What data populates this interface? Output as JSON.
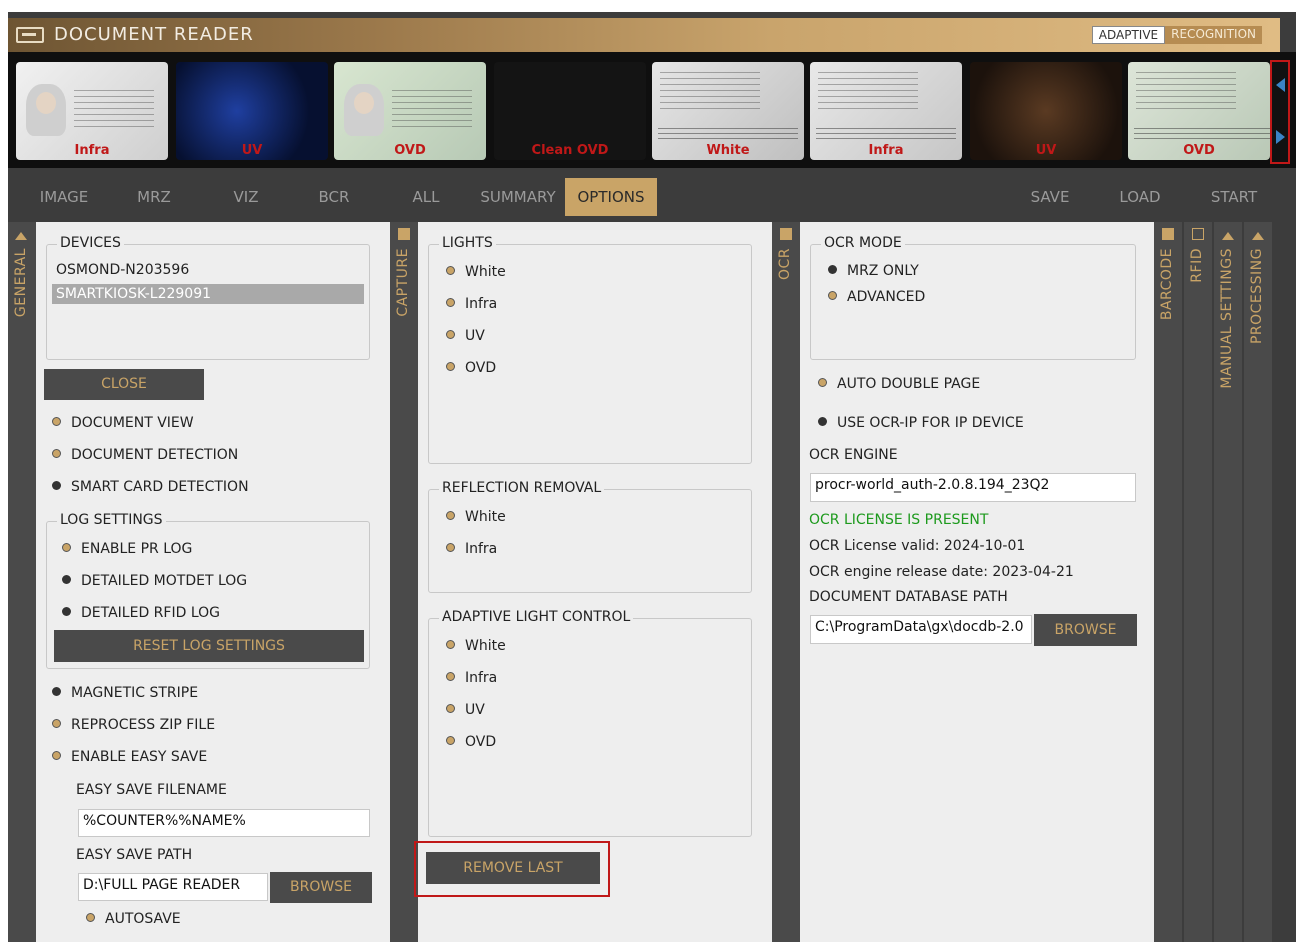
{
  "app": {
    "title": "DOCUMENT READER",
    "brand_left": "ADAPTIVE",
    "brand_right": "RECOGNITION"
  },
  "thumbnails": [
    {
      "label": "Infra"
    },
    {
      "label": "UV"
    },
    {
      "label": "OVD"
    },
    {
      "label": "Clean OVD"
    },
    {
      "label": "White"
    },
    {
      "label": "Infra"
    },
    {
      "label": "UV"
    },
    {
      "label": "OVD"
    }
  ],
  "tabs": {
    "image": "IMAGE",
    "mrz": "MRZ",
    "viz": "VIZ",
    "bcr": "BCR",
    "all": "ALL",
    "summary": "SUMMARY",
    "options": "OPTIONS",
    "save": "SAVE",
    "load": "LOAD",
    "start": "START"
  },
  "side_tabs": {
    "general": "GENERAL",
    "capture": "CAPTURE",
    "ocr": "OCR",
    "barcode": "BARCODE",
    "rfid": "RFID",
    "manual_settings": "MANUAL SETTINGS",
    "processing": "PROCESSING"
  },
  "general": {
    "devices_legend": "DEVICES",
    "devices": [
      "OSMOND-N203596",
      "SMARTKIOSK-L229091"
    ],
    "close": "CLOSE",
    "document_view": "DOCUMENT VIEW",
    "document_detection": "DOCUMENT DETECTION",
    "smart_card_detection": "SMART CARD DETECTION",
    "log_legend": "LOG SETTINGS",
    "enable_pr_log": "ENABLE PR LOG",
    "detailed_motdet_log": "DETAILED MOTDET LOG",
    "detailed_rfid_log": "DETAILED RFID LOG",
    "reset_log": "RESET LOG SETTINGS",
    "magnetic_stripe": "MAGNETIC STRIPE",
    "reprocess_zip": "REPROCESS ZIP FILE",
    "enable_easy_save": "ENABLE EASY SAVE",
    "easy_save_filename_label": "EASY SAVE FILENAME",
    "easy_save_filename": "%COUNTER%%NAME%",
    "easy_save_path_label": "EASY SAVE PATH",
    "easy_save_path": "D:\\FULL PAGE READER",
    "browse": "BROWSE",
    "autosave": "AUTOSAVE"
  },
  "capture": {
    "lights_legend": "LIGHTS",
    "lights": [
      "White",
      "Infra",
      "UV",
      "OVD"
    ],
    "reflection_legend": "REFLECTION REMOVAL",
    "reflection": [
      "White",
      "Infra"
    ],
    "adaptive_legend": "ADAPTIVE LIGHT CONTROL",
    "adaptive": [
      "White",
      "Infra",
      "UV",
      "OVD"
    ],
    "remove_last": "REMOVE LAST"
  },
  "ocr": {
    "mode_legend": "OCR MODE",
    "mrz_only": "MRZ ONLY",
    "advanced": "ADVANCED",
    "auto_double_page": "AUTO DOUBLE PAGE",
    "use_ocr_ip": "USE OCR-IP FOR IP DEVICE",
    "engine_label": "OCR ENGINE",
    "engine_value": "procr-world_auth-2.0.8.194_23Q2",
    "license_present": "OCR LICENSE IS PRESENT",
    "license_valid": "OCR License valid: 2024-10-01",
    "release_date": "OCR engine release date: 2023-04-21",
    "db_path_label": "DOCUMENT DATABASE PATH",
    "db_path": "C:\\ProgramData\\gx\\docdb-2.0",
    "browse": "BROWSE"
  },
  "colors": {
    "accent": "#c9a467",
    "dark": "#3c3c3c",
    "panel": "#eeeeee",
    "highlight": "#c01818",
    "license_ok": "#1d9a1d"
  }
}
